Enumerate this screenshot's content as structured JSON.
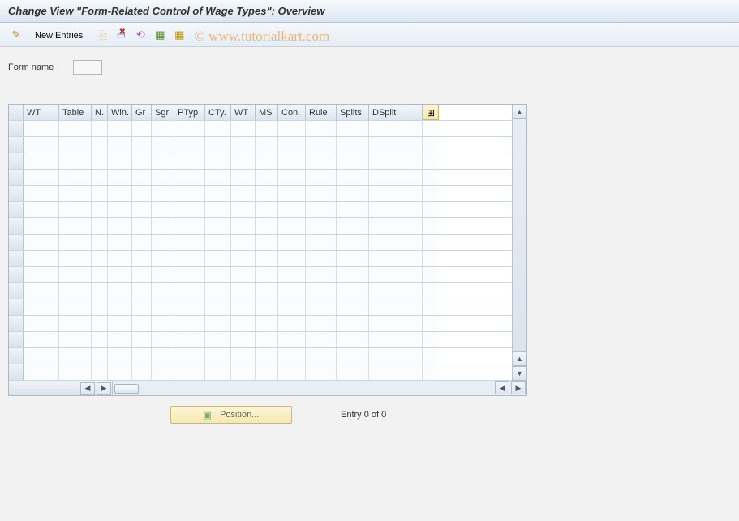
{
  "title": "Change View \"Form-Related Control of Wage Types\": Overview",
  "watermark": "© www.tutorialkart.com",
  "toolbar": {
    "new_entries_label": "New Entries"
  },
  "form": {
    "name_label": "Form name",
    "name_value": ""
  },
  "table": {
    "columns": [
      "WT",
      "Table",
      "N..",
      "Win.",
      "Gr",
      "Sgr",
      "PTyp",
      "CTy.",
      "WT",
      "MS",
      "Con.",
      "Rule",
      "Splits",
      "DSplit"
    ],
    "rows": []
  },
  "footer": {
    "position_label": "Position...",
    "entry_text": "Entry 0 of 0"
  }
}
